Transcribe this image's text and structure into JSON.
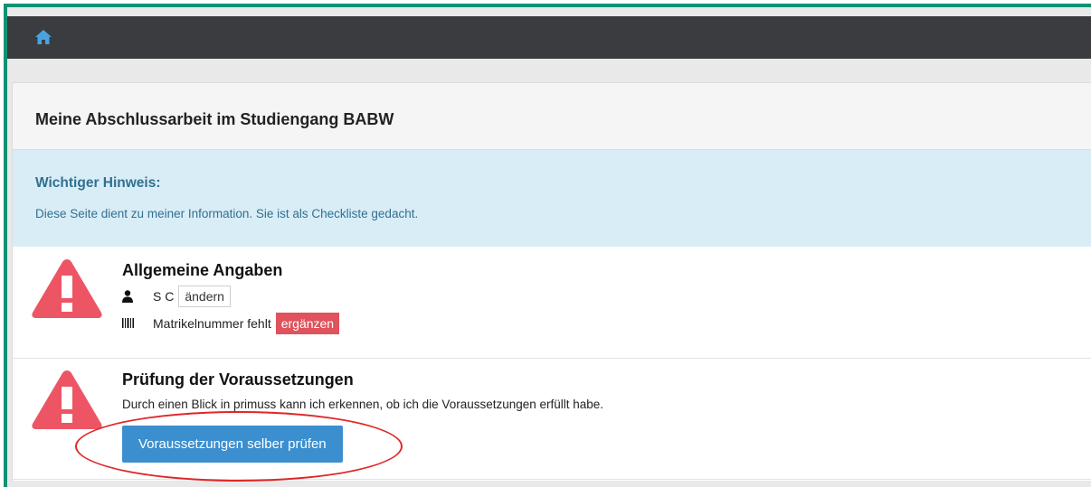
{
  "header": {
    "home_icon": "home-icon"
  },
  "panel": {
    "title": "Meine Abschlussarbeit im Studiengang BABW"
  },
  "notice": {
    "title": "Wichtiger Hinweis:",
    "text": "Diese Seite dient zu meiner Information. Sie ist als Checkliste gedacht."
  },
  "sections": [
    {
      "title": "Allgemeine Angaben",
      "name_value": "S C",
      "name_button": "ändern",
      "matrikel_text": "Matrikelnummer fehlt",
      "matrikel_button": "ergänzen"
    },
    {
      "title": "Prüfung der Voraussetzungen",
      "description": "Durch einen Blick in primuss kann ich erkennen, ob ich die Voraussetzungen erfüllt habe.",
      "button": "Voraussetzungen selber prüfen"
    }
  ],
  "colors": {
    "border_accent": "#129173",
    "navbar": "#3a3c3f",
    "warning": "#ed5565",
    "danger_button": "#e0525c",
    "primary_button": "#3c8fcf",
    "notice_bg": "#d9edf7",
    "notice_text": "#31708f",
    "annotation": "#e02626"
  }
}
